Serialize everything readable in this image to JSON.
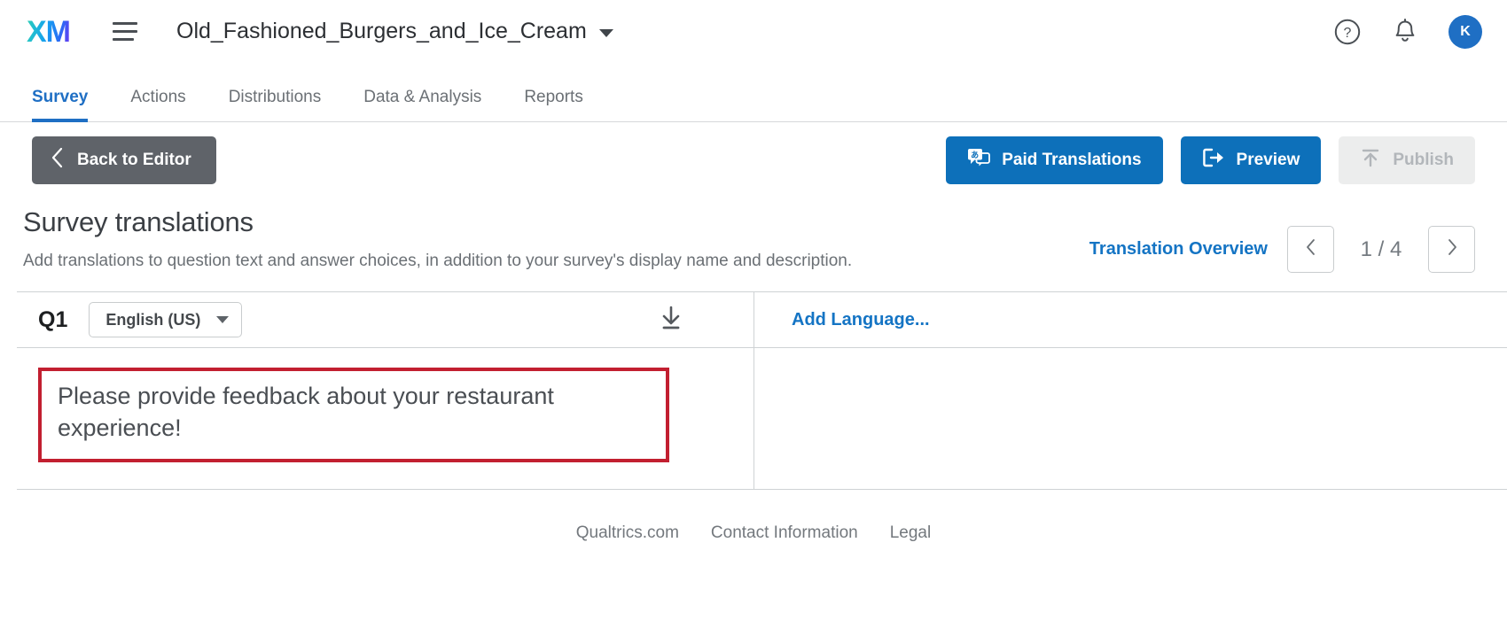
{
  "topbar": {
    "logo_text": "XM",
    "project_title": "Old_Fashioned_Burgers_and_Ice_Cream",
    "help_icon": "help-circle-icon",
    "notification_icon": "bell-icon",
    "avatar_initial": "K",
    "avatar_color": "#1f6fc4"
  },
  "nav": {
    "tabs": [
      {
        "label": "Survey",
        "active": true
      },
      {
        "label": "Actions",
        "active": false
      },
      {
        "label": "Distributions",
        "active": false
      },
      {
        "label": "Data & Analysis",
        "active": false
      },
      {
        "label": "Reports",
        "active": false
      }
    ],
    "active_color": "#1f6fc4"
  },
  "actionbar": {
    "back_label": "Back to Editor",
    "back_icon": "chevron-left-icon",
    "paid_translations_label": "Paid Translations",
    "paid_translations_icon": "translate-bubble-icon",
    "preview_label": "Preview",
    "preview_icon": "external-launch-icon",
    "publish_label": "Publish",
    "publish_icon": "upload-arrow-icon",
    "publish_disabled": true,
    "primary_color": "#0d70ba",
    "back_color": "#5f6369"
  },
  "page": {
    "title": "Survey translations",
    "description": "Add translations to question text and answer choices, in addition to your survey's display name and description.",
    "overview_link": "Translation Overview",
    "prev_icon": "chevron-left-icon",
    "next_icon": "chevron-right-icon",
    "page_indicator": "1 / 4"
  },
  "table": {
    "question_label": "Q1",
    "language_selected": "English (US)",
    "language_caret_icon": "chevron-down-icon",
    "download_icon": "download-icon",
    "add_language_label": "Add Language...",
    "question_text": "Please provide feedback about your restaurant experience!",
    "highlight_color": "#c21f30"
  },
  "footer": {
    "links": [
      "Qualtrics.com",
      "Contact Information",
      "Legal"
    ]
  }
}
